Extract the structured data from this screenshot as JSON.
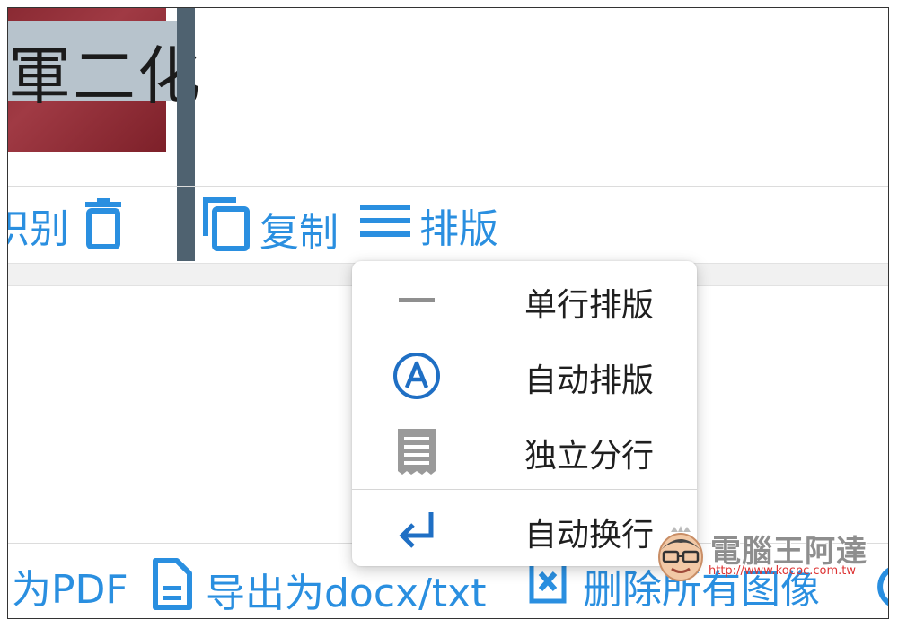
{
  "image_text": "軍二化",
  "toolbar": {
    "recognize_partial": "识别",
    "copy_label": "复制",
    "layout_label": "排版"
  },
  "menu": {
    "items": [
      {
        "label": "单行排版",
        "icon": "horizontal-line-icon"
      },
      {
        "label": "自动排版",
        "icon": "circled-a-icon"
      },
      {
        "label": "独立分行",
        "icon": "paragraph-document-icon"
      },
      {
        "label": "自动换行",
        "icon": "return-arrow-icon"
      }
    ]
  },
  "bottom_bar": {
    "export_pdf_partial": "为PDF",
    "export_docx_label": "导出为docx/txt",
    "delete_all_label": "删除所有图像"
  },
  "watermark": {
    "title": "電腦王阿達",
    "url": "http://www.kocpc.com.tw"
  },
  "colors": {
    "accent": "#2a8fe0",
    "menu_icon_blue": "#1f6fc4",
    "menu_icon_gray": "#8f8f8f"
  }
}
